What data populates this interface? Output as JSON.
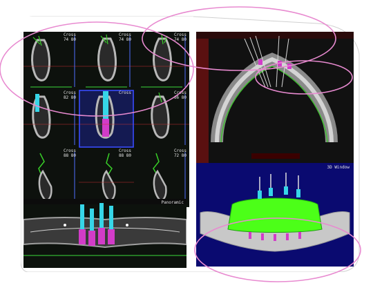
{
  "cross_sections": [
    {
      "label": "Cross",
      "num": "74 80"
    },
    {
      "label": "Cross",
      "num": "74 80"
    },
    {
      "label": "Cross",
      "num": "74 80"
    },
    {
      "label": "Cross",
      "num": "82 80"
    },
    {
      "label": "Cross",
      "num": ""
    },
    {
      "label": "Cross",
      "num": "66 80"
    },
    {
      "label": "Cross",
      "num": "88 80"
    },
    {
      "label": "Cross",
      "num": "88 80"
    },
    {
      "label": "Cross",
      "num": "72 80"
    }
  ],
  "panoramic": {
    "label": "Panoramic"
  },
  "window3d": {
    "label": "3D Window"
  },
  "colors": {
    "highlight": "#e88ad0",
    "implant_cyan": "#36d6e8",
    "implant_magenta": "#d23cc8",
    "bone_green": "#49ff1a",
    "background_3d": "#0a0a70"
  }
}
